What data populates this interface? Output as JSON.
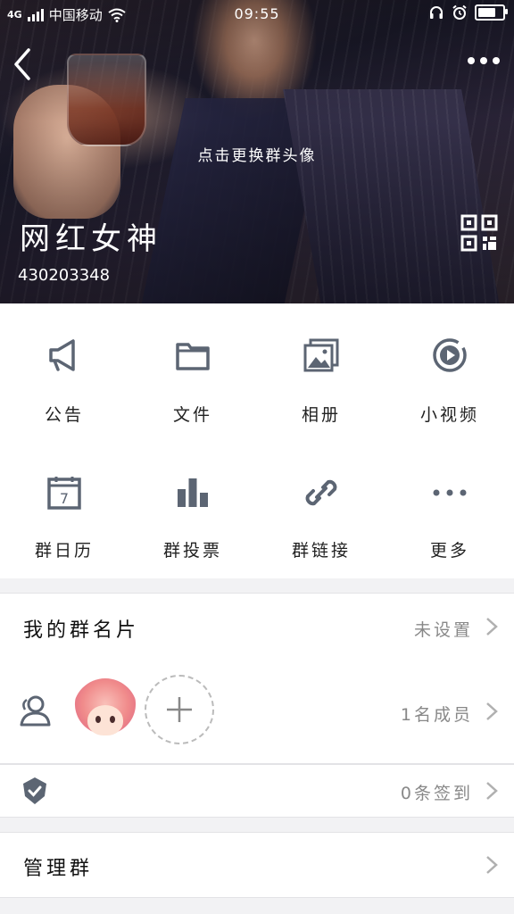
{
  "status_bar": {
    "network": "4G",
    "carrier": "中国移动",
    "time": "09:55",
    "battery_level": 0.85
  },
  "header": {
    "hint": "点击更换群头像",
    "group_name": "网红女神",
    "group_id": "430203348"
  },
  "grid": {
    "items": [
      {
        "label": "公告",
        "icon": "megaphone-icon"
      },
      {
        "label": "文件",
        "icon": "folder-icon"
      },
      {
        "label": "相册",
        "icon": "album-icon"
      },
      {
        "label": "小视频",
        "icon": "video-play-icon"
      },
      {
        "label": "群日历",
        "icon": "calendar-icon"
      },
      {
        "label": "群投票",
        "icon": "bar-chart-icon"
      },
      {
        "label": "群链接",
        "icon": "link-icon"
      },
      {
        "label": "更多",
        "icon": "more-dots-icon"
      }
    ],
    "calendar_day": "7"
  },
  "card_row": {
    "title": "我的群名片",
    "value": "未设置"
  },
  "members_row": {
    "value": "1名成员"
  },
  "signin_row": {
    "value": "0条签到"
  },
  "manage_row": {
    "title": "管理群"
  },
  "colors": {
    "icon_gray": "#5c6573",
    "text_gray": "#888888",
    "divider": "#e3e3e6"
  }
}
